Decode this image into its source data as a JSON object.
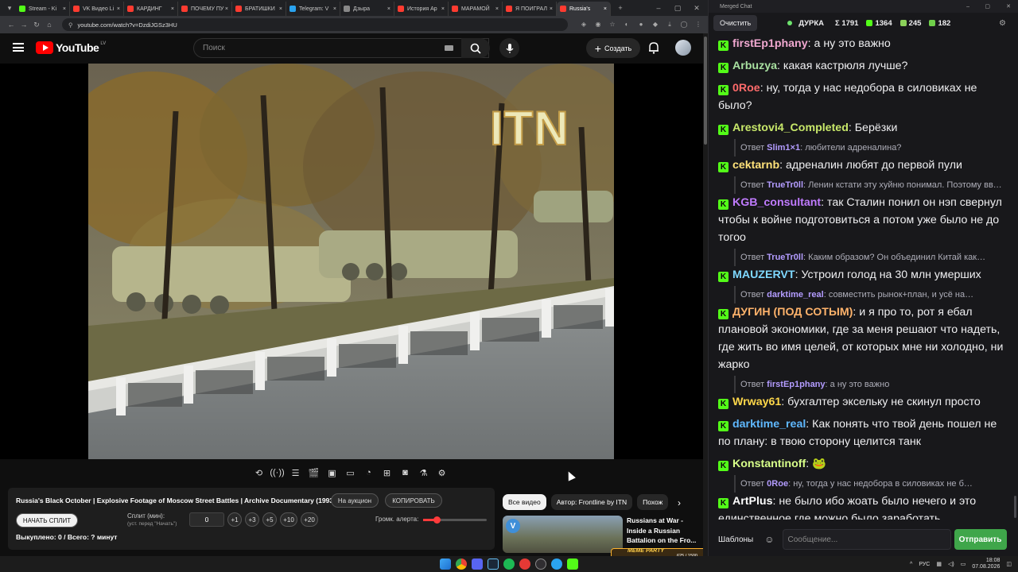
{
  "browser": {
    "tabs": [
      {
        "label": "Stream - Ki",
        "color": "#53fc18"
      },
      {
        "label": "VK Видео Li",
        "color": "#ff3b30"
      },
      {
        "label": "КАРДИНГ",
        "color": "#ff3b30"
      },
      {
        "label": "ПОЧЕМУ ПУ",
        "color": "#ff3b30"
      },
      {
        "label": "БРАТИШКИ",
        "color": "#ff3b30"
      },
      {
        "label": "Telegram: V",
        "color": "#2aa3ef"
      },
      {
        "label": "Дзыра",
        "color": "#888888"
      },
      {
        "label": "История Ар",
        "color": "#ff3b30"
      },
      {
        "label": "МАРАМОЙ",
        "color": "#ff3b30"
      },
      {
        "label": "Я ПОИГРАЛ",
        "color": "#ff3b30"
      },
      {
        "label": "Russia's",
        "color": "#ff3b30",
        "active": true
      }
    ],
    "url": "youtube.com/watch?v=DzdiJGSz3HU"
  },
  "youtube": {
    "logo_text": "YouTube",
    "region": "LV",
    "search_placeholder": "Поиск",
    "create_label": "Создать"
  },
  "video": {
    "watermark": "ITN"
  },
  "info": {
    "title": "Russia's Black October | Explosive Footage of Moscow Street Battles | Archive Documentary (1993)",
    "auction_label": "На аукцион",
    "copy_label": "КОПИРОВАТЬ",
    "split_label": "НАЧАТЬ СПЛИТ",
    "split_min_label": "Сплит (мин):",
    "split_min_hint": "(уст. перед \"Начать\")",
    "split_value": "0",
    "plus_buttons": [
      "+1",
      "+3",
      "+5",
      "+10",
      "+20"
    ],
    "alert_volume_label": "Громк. алерта:",
    "bought_text": "Выкуплено: 0 / Всего: ? минут"
  },
  "related": {
    "chips": [
      "Все видео",
      "Автор: Frontline by ITN",
      "Похож"
    ],
    "card_title": "Russians at War - Inside a Russian Battalion on the Fro...",
    "overlay_badge": "MEME PARTY",
    "overlay_progress": "625 / 1500"
  },
  "chat": {
    "window_title": "Merged Chat",
    "clear_label": "Очистить",
    "channel": "ДУРКА",
    "stats": [
      {
        "icon": "sigma-icon",
        "value": "Σ 1791"
      },
      {
        "icon": "kick-icon",
        "value": "1364"
      },
      {
        "icon": "pepe-icon",
        "value": "245"
      },
      {
        "icon": "vk-icon",
        "value": "182"
      }
    ],
    "messages": [
      {
        "type": "msg",
        "user": "firstEp1phany",
        "color": "#f0a8d0",
        "text": "а ну это важно"
      },
      {
        "type": "msg",
        "user": "Arbuzya",
        "color": "#a8e0a0",
        "text": "какая кастрюля лучше?"
      },
      {
        "type": "msg",
        "user": "0Roe",
        "color": "#ff6b6b",
        "text": "ну, тогда у нас недобора в силовиках не было?"
      },
      {
        "type": "msg",
        "user": "Arestovi4_Completed",
        "color": "#c8e86a",
        "text": "Берёзки"
      },
      {
        "type": "reply",
        "prefix": "Ответ",
        "user": "Slim1×1",
        "color": "#b39cff",
        "text": "любители адреналина?"
      },
      {
        "type": "msg",
        "user": "cektarnb",
        "color": "#ffe27a",
        "text": "адреналин любят до первой пули"
      },
      {
        "type": "reply",
        "prefix": "Ответ",
        "user": "TrueTr0ll",
        "color": "#b39cff",
        "text": "Ленин кстати эту хуйню понимал. Поэтому вве…"
      },
      {
        "type": "msg",
        "user": "KGB_consultant",
        "color": "#c07bff",
        "text": "так Сталин понил он нэп свернул чтобы к войне подготовиться а потом уже было не до тогоо"
      },
      {
        "type": "reply",
        "prefix": "Ответ",
        "user": "TrueTr0ll",
        "color": "#b39cff",
        "text": "Каким образом? Он объединил Китай как…"
      },
      {
        "type": "msg",
        "user": "MAUZERVT",
        "color": "#7fd8ff",
        "text": "Устроил голод на 30 млн умерших"
      },
      {
        "type": "reply",
        "prefix": "Ответ",
        "user": "darktime_real",
        "color": "#b39cff",
        "text": "совместить рынок+план, и усё на…"
      },
      {
        "type": "msg",
        "user": "ДУГИН (ПОД СОТЫМ)",
        "color": "#ffb36b",
        "text": "и я про то, рот я ебал плановой экономики, где за меня решают что надеть, где жить во имя целей, от которых мне ни холодно, ни жарко"
      },
      {
        "type": "reply",
        "prefix": "Ответ",
        "user": "firstEp1phany",
        "color": "#b39cff",
        "text": "а ну это важно"
      },
      {
        "type": "msg",
        "user": "Wrway61",
        "color": "#ffd84a",
        "text": "бухгалтер экселькy не скинул просто"
      },
      {
        "type": "msg",
        "user": "darktime_real",
        "color": "#5fb8ff",
        "text": "Как понять что твой день пошел не по плану: в твою сторону целится танк"
      },
      {
        "type": "msg",
        "user": "Konstantinoff",
        "color": "#d8ff8a",
        "text": "🐸"
      },
      {
        "type": "reply",
        "prefix": "Ответ",
        "user": "0Roe",
        "color": "#b39cff",
        "text": "ну, тогда у нас недобора в силовиках не б…"
      },
      {
        "type": "msg",
        "user": "ArtPlus",
        "color": "#ffffff",
        "text": "не было ибо жоать было нечего и это единственное где можно было заработать"
      }
    ],
    "templates_label": "Шаблоны",
    "input_placeholder": "Сообщение...",
    "send_label": "Отправить"
  },
  "taskbar": {
    "lang": "РУС",
    "time": "18:08",
    "date": "07.08.2026"
  }
}
